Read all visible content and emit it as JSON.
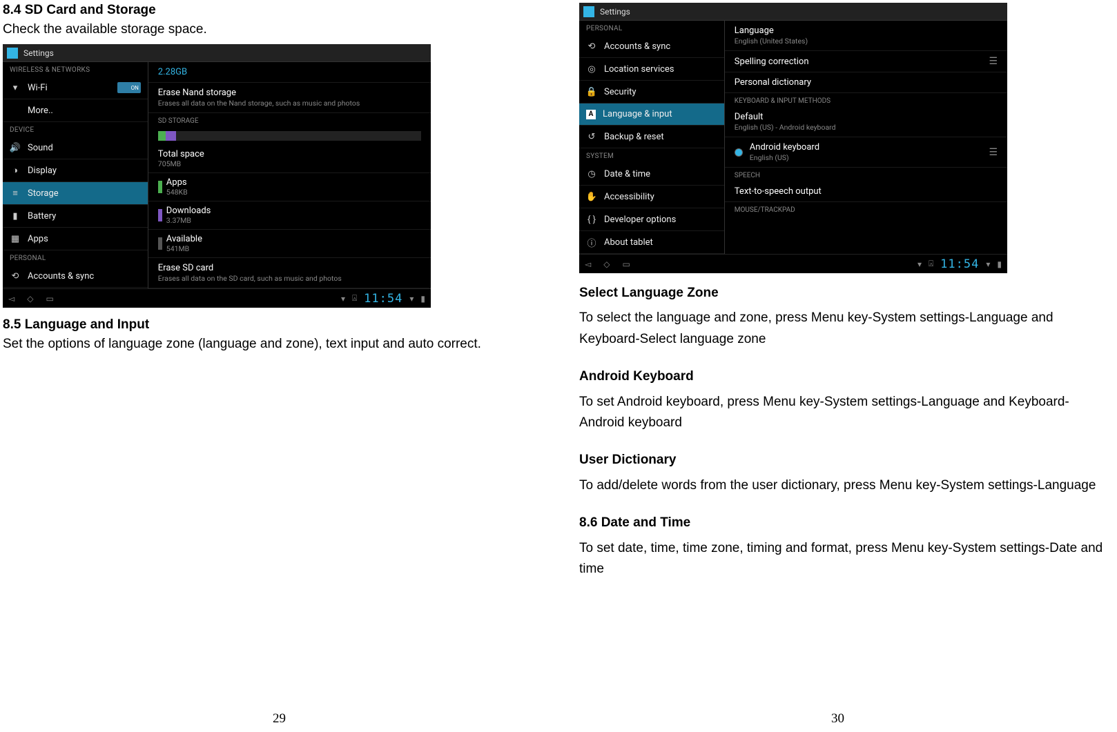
{
  "left": {
    "h1": "8.4 SD Card and Storage",
    "p1": "Check the available storage space.",
    "h2": "8.5 Language and Input",
    "p2": "Set the options of language zone (language and zone), text input and auto correct.",
    "pagenum": "29"
  },
  "right": {
    "h1": "Select Language Zone",
    "p1": "To select the language and zone, press Menu key-System settings-Language and Keyboard-Select language zone",
    "h2": "Android Keyboard",
    "p2": "To set Android keyboard, press Menu key-System settings-Language and Keyboard-Android keyboard",
    "h3": "User Dictionary",
    "p3": "To add/delete words from the user dictionary, press Menu key-System settings-Language",
    "h4": "8.6 Date and Time",
    "p4": "To set date, time, time zone, timing and format, press Menu key-System settings-Date and time",
    "pagenum": "30"
  },
  "shot1": {
    "title": "Settings",
    "cat1": "WIRELESS & NETWORKS",
    "wifi": "Wi-Fi",
    "wifi_on": "ON",
    "more": "More..",
    "cat2": "DEVICE",
    "sound": "Sound",
    "display": "Display",
    "storage": "Storage",
    "battery": "Battery",
    "apps": "Apps",
    "cat3": "PERSONAL",
    "accounts": "Accounts & sync",
    "r_used": "2.28GB",
    "r_erase_t": "Erase Nand storage",
    "r_erase_s": "Erases all data on the Nand storage, such as music and photos",
    "r_sd": "SD STORAGE",
    "r_total_t": "Total space",
    "r_total_s": "705MB",
    "r_apps_t": "Apps",
    "r_apps_s": "548KB",
    "r_dl_t": "Downloads",
    "r_dl_s": "3.37MB",
    "r_avail_t": "Available",
    "r_avail_s": "541MB",
    "r_erasesd_t": "Erase SD card",
    "r_erasesd_s": "Erases all data on the SD card, such as music and photos",
    "clock": "11:54"
  },
  "shot2": {
    "title": "Settings",
    "cat1": "PERSONAL",
    "accounts": "Accounts & sync",
    "location": "Location services",
    "security": "Security",
    "lang": "Language & input",
    "backup": "Backup & reset",
    "cat2": "SYSTEM",
    "date": "Date & time",
    "access": "Accessibility",
    "dev": "Developer options",
    "about": "About tablet",
    "r_lang_t": "Language",
    "r_lang_s": "English (United States)",
    "r_spell": "Spelling correction",
    "r_dict": "Personal dictionary",
    "r_kb": "KEYBOARD & INPUT METHODS",
    "r_def_t": "Default",
    "r_def_s": "English (US) - Android keyboard",
    "r_and_t": "Android keyboard",
    "r_and_s": "English (US)",
    "r_speech": "SPEECH",
    "r_tts": "Text-to-speech output",
    "r_mouse": "MOUSE/TRACKPAD",
    "clock": "11:54"
  }
}
